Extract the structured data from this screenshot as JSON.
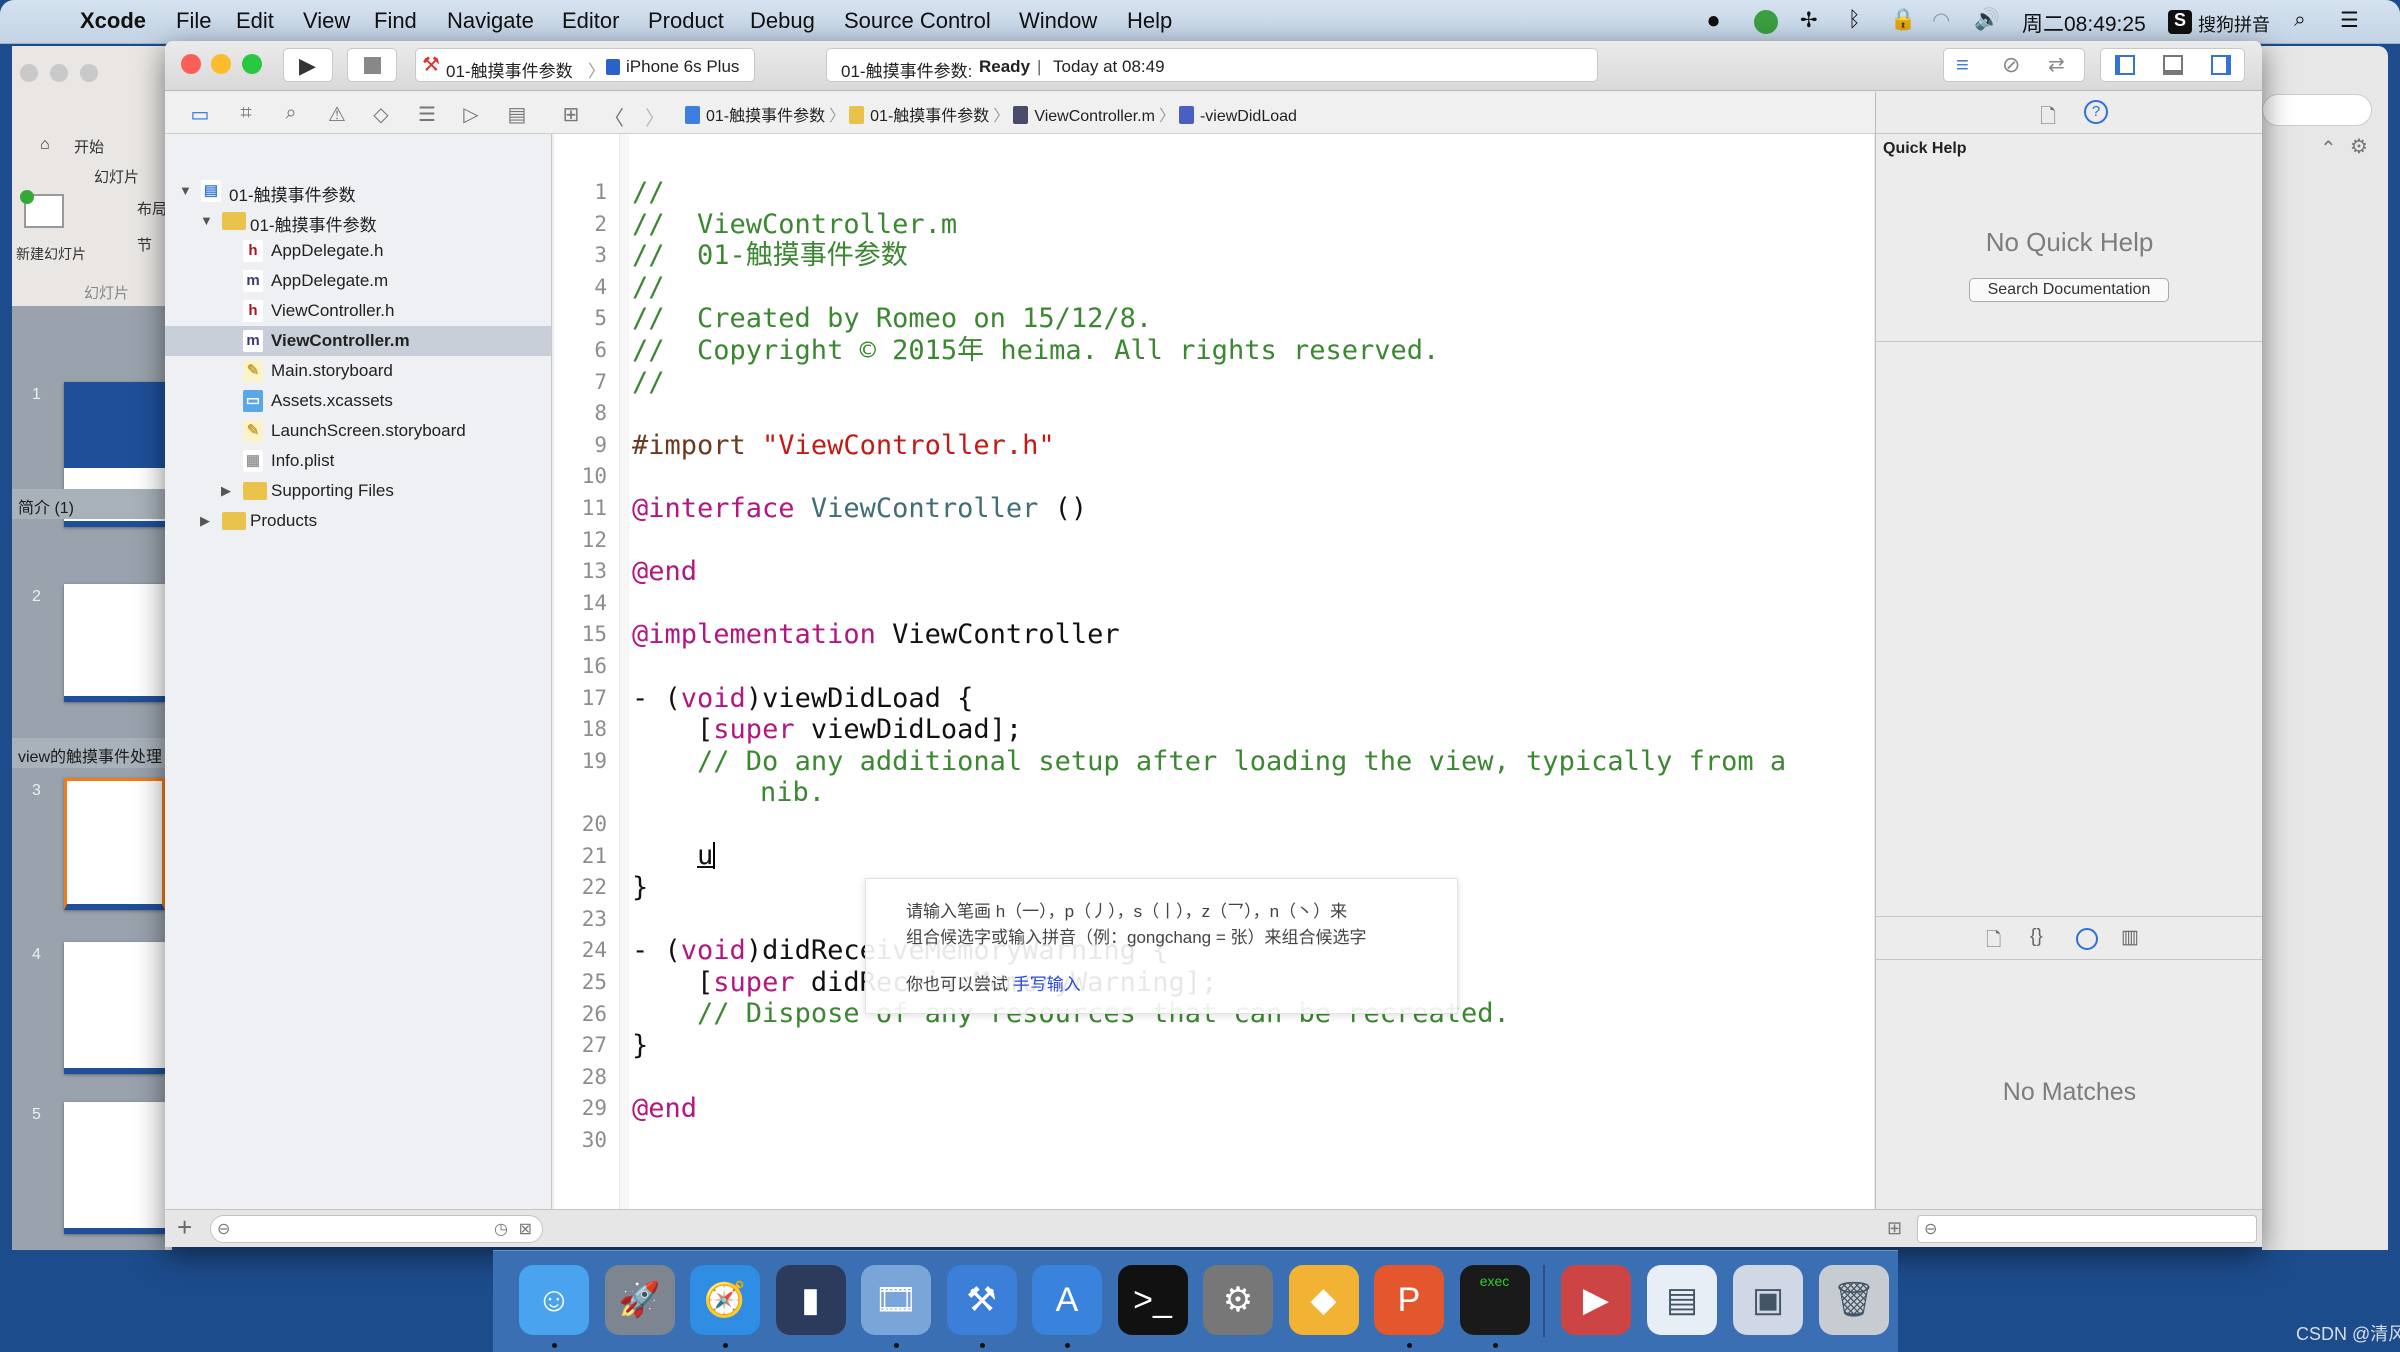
{
  "menubar": {
    "app": "Xcode",
    "items": [
      "File",
      "Edit",
      "View",
      "Find",
      "Navigate",
      "Editor",
      "Product",
      "Debug",
      "Source Control",
      "Window",
      "Help"
    ],
    "clock": "周二08:49:25",
    "ime": "搜狗拼音"
  },
  "keynote": {
    "tab_home": "开始",
    "group_slides": "幻灯片",
    "new_slide": "新建幻灯片",
    "layout": "布局",
    "section": "节",
    "slides_tab": "幻灯片",
    "sections": [
      "简介 (1)",
      "view的触摸事件处理"
    ],
    "slide_numbers": [
      "1",
      "2",
      "3",
      "4",
      "5"
    ]
  },
  "toolbar": {
    "scheme": "01-触摸事件参数",
    "device": "iPhone 6s Plus",
    "activity_project": "01-触摸事件参数:",
    "activity_status": "Ready",
    "activity_time": "Today at 08:49"
  },
  "jumpbar": [
    "01-触摸事件参数",
    "01-触摸事件参数",
    "ViewController.m",
    "-viewDidLoad"
  ],
  "navigator": {
    "items": [
      {
        "label": "01-触摸事件参数",
        "icon": "project",
        "depth": 0,
        "disclosure": "open"
      },
      {
        "label": "01-触摸事件参数",
        "icon": "folder",
        "depth": 1,
        "disclosure": "open"
      },
      {
        "label": "AppDelegate.h",
        "icon": "h",
        "depth": 2
      },
      {
        "label": "AppDelegate.m",
        "icon": "m",
        "depth": 2
      },
      {
        "label": "ViewController.h",
        "icon": "h",
        "depth": 2
      },
      {
        "label": "ViewController.m",
        "icon": "m",
        "depth": 2,
        "selected": true
      },
      {
        "label": "Main.storyboard",
        "icon": "storyboard",
        "depth": 2
      },
      {
        "label": "Assets.xcassets",
        "icon": "assets",
        "depth": 2
      },
      {
        "label": "LaunchScreen.storyboard",
        "icon": "storyboard",
        "depth": 2
      },
      {
        "label": "Info.plist",
        "icon": "plist",
        "depth": 2
      },
      {
        "label": "Supporting Files",
        "icon": "folder",
        "depth": 2,
        "disclosure": "closed"
      },
      {
        "label": "Products",
        "icon": "folder",
        "depth": 1,
        "disclosure": "closed"
      }
    ]
  },
  "code": [
    [
      [
        "//",
        "comment"
      ]
    ],
    [
      [
        "//  ViewController.m",
        "comment"
      ]
    ],
    [
      [
        "//  01-触摸事件参数",
        "comment"
      ]
    ],
    [
      [
        "//",
        "comment"
      ]
    ],
    [
      [
        "//  Created by Romeo on 15/12/8.",
        "comment"
      ]
    ],
    [
      [
        "//  Copyright © 2015年 heima. All rights reserved.",
        "comment"
      ]
    ],
    [
      [
        "//",
        "comment"
      ]
    ],
    [],
    [
      [
        "#import ",
        "pre"
      ],
      [
        "\"ViewController.h\"",
        "string"
      ]
    ],
    [],
    [
      [
        "@interface",
        "keyword"
      ],
      [
        " ",
        ""
      ],
      [
        "ViewController",
        "cls"
      ],
      [
        " ()",
        ""
      ]
    ],
    [],
    [
      [
        "@end",
        "keyword"
      ]
    ],
    [],
    [
      [
        "@implementation",
        "keyword"
      ],
      [
        " ViewController",
        ""
      ]
    ],
    [],
    [
      [
        "- (",
        ""
      ],
      [
        "void",
        "keyword"
      ],
      [
        ")viewDidLoad {",
        ""
      ]
    ],
    [
      [
        "    [",
        ""
      ],
      [
        "super",
        "keyword"
      ],
      [
        " viewDidLoad];",
        ""
      ]
    ],
    [
      [
        "    // Do any additional setup after loading the view, typically from a nib.",
        "comment"
      ]
    ],
    [],
    [
      [
        "    ",
        ""
      ],
      [
        "u",
        "ime"
      ]
    ],
    [
      [
        "}",
        ""
      ]
    ],
    [],
    [
      [
        "- (",
        ""
      ],
      [
        "void",
        "keyword"
      ],
      [
        ")didReceiveMemoryWarning {",
        ""
      ]
    ],
    [
      [
        "    [",
        ""
      ],
      [
        "super",
        "keyword"
      ],
      [
        " didReceiveMemoryWarning];",
        ""
      ]
    ],
    [
      [
        "    // Dispose of any resources that can be recreated.",
        "comment"
      ]
    ],
    [
      [
        "}",
        ""
      ]
    ],
    [],
    [
      [
        "@end",
        "keyword"
      ]
    ],
    []
  ],
  "ime_popup": {
    "line1": "请输入笔画 h（一），p（丿），s（丨），z（乛），n（丶）来",
    "line2": "组合候选字或输入拼音（例：gongchang = 张）来组合候选字",
    "line3": "你也可以尝试 ",
    "link": "手写输入"
  },
  "inspector": {
    "title": "Quick Help",
    "empty": "No Quick Help",
    "search_button": "Search Documentation",
    "library_empty": "No Matches"
  },
  "dock": [
    {
      "name": "finder",
      "color": "#4aa3ef",
      "glyph": "☺",
      "running": true
    },
    {
      "name": "launchpad",
      "color": "#7d8590",
      "glyph": "🚀",
      "running": false
    },
    {
      "name": "safari",
      "color": "#2f8de4",
      "glyph": "🧭",
      "running": true
    },
    {
      "name": "mouse-app",
      "color": "#2c3b5c",
      "glyph": "▮",
      "running": false
    },
    {
      "name": "photo-slideshow",
      "color": "#7aa5d8",
      "glyph": "🎞",
      "running": true
    },
    {
      "name": "xcode",
      "color": "#3b7fd9",
      "glyph": "⚒",
      "running": true
    },
    {
      "name": "instruments",
      "color": "#3a83dc",
      "glyph": "A",
      "running": true
    },
    {
      "name": "terminal",
      "color": "#111",
      "glyph": ">_",
      "running": false
    },
    {
      "name": "system-preferences",
      "color": "#777",
      "glyph": "⚙",
      "running": false
    },
    {
      "name": "sketch",
      "color": "#f2b233",
      "glyph": "◆",
      "running": false
    },
    {
      "name": "keynote-p",
      "color": "#e4572e",
      "glyph": "P",
      "running": true
    },
    {
      "name": "console",
      "color": "#1a1a1a",
      "glyph": "exec",
      "running": true
    },
    {
      "name": "media-player",
      "color": "#c44",
      "glyph": "▶",
      "running": false
    },
    {
      "name": "document-window",
      "color": "#e8eef6",
      "glyph": "▤",
      "running": false
    },
    {
      "name": "display-window",
      "color": "#cfd8e4",
      "glyph": "▣",
      "running": false
    },
    {
      "name": "trash",
      "color": "#c7ccd2",
      "glyph": "🗑",
      "running": false
    }
  ],
  "watermark": "CSDN @清风清晨"
}
